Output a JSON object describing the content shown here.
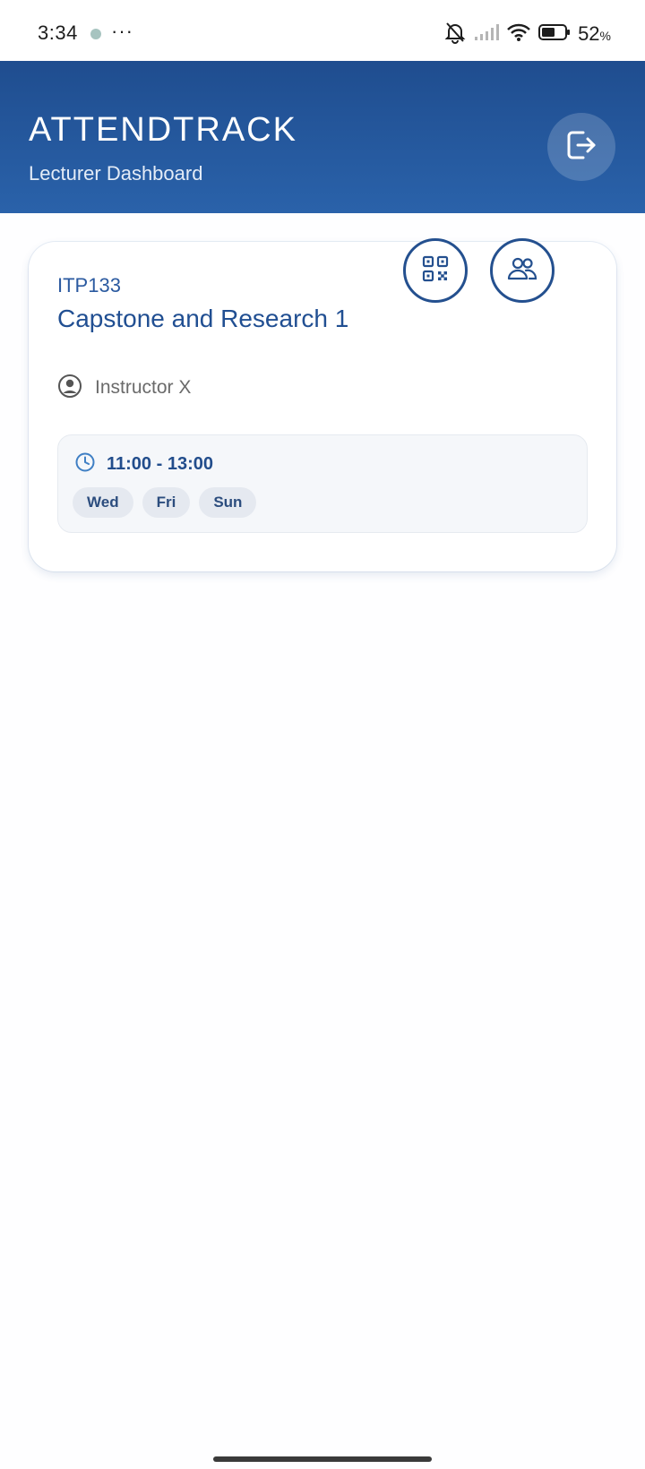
{
  "status_bar": {
    "time": "3:34",
    "more": "···",
    "battery_percent": "52",
    "battery_unit": "%",
    "icons": [
      "app-notification-icon",
      "silent-bell-icon",
      "signal-icon",
      "wifi-icon",
      "battery-icon"
    ]
  },
  "header": {
    "title": "ATTENDTRACK",
    "subtitle": "Lecturer Dashboard",
    "logout_icon": "logout-icon",
    "colors": {
      "gradient_top": "#1f4d8f",
      "gradient_bottom": "#2a62aa"
    }
  },
  "course": {
    "code": "ITP133",
    "name": "Capstone and Research 1",
    "instructor": "Instructor X",
    "time": "11:00 - 13:00",
    "days": [
      "Wed",
      "Fri",
      "Sun"
    ],
    "actions": [
      "qr-code-icon",
      "students-icon"
    ]
  },
  "colors": {
    "accent": "#24508f",
    "text_muted": "#6b6b6b",
    "chip_bg": "#e5e9f0"
  }
}
